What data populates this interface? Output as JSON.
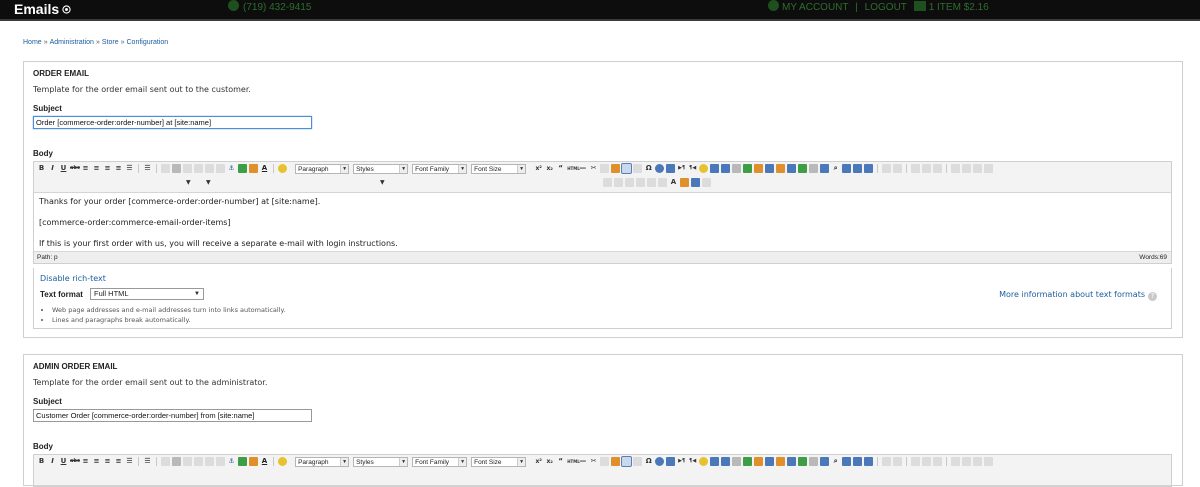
{
  "topbar": {
    "title": "Emails",
    "phone": "(719) 432-9415",
    "my_account": "MY ACCOUNT",
    "sep": "|",
    "logout": "LOGOUT",
    "cart": "1 ITEM  $2.16"
  },
  "breadcrumb": [
    "Home",
    "Administration",
    "Store",
    "Configuration"
  ],
  "breadcrumb_sep": "»",
  "sections": [
    {
      "title": "ORDER EMAIL",
      "description": "Template for the order email sent out to the customer.",
      "subject_label": "Subject",
      "subject_value": "Order [commerce-order:order-number] at [site:name]",
      "body_label": "Body",
      "body_lines": [
        "Thanks for your order [commerce-order:order-number] at [site:name].",
        "[commerce-order:commerce-email-order-items]",
        "If this is your first order with us, you will receive a separate e-mail with login instructions."
      ],
      "path": "Path: p",
      "words": "Words:69",
      "disable_rich_text": "Disable rich-text",
      "text_format_label": "Text format",
      "text_format_value": "Full HTML",
      "more_info": "More information about text formats",
      "tips": [
        "Web page addresses and e-mail addresses turn into links automatically.",
        "Lines and paragraphs break automatically."
      ]
    },
    {
      "title": "ADMIN ORDER EMAIL",
      "description": "Template for the order email sent out to the administrator.",
      "subject_label": "Subject",
      "subject_value": "Customer Order [commerce-order:order-number] from [site:name]",
      "body_label": "Body"
    }
  ],
  "toolbar": {
    "paragraph": "Paragraph",
    "styles": "Styles",
    "font_family": "Font Family",
    "font_size": "Font Size"
  }
}
